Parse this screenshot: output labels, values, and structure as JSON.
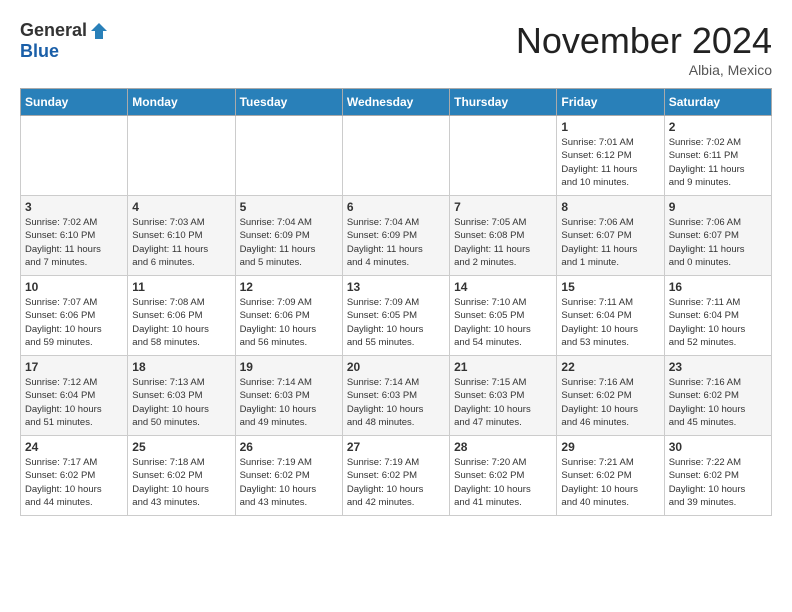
{
  "logo": {
    "general": "General",
    "blue": "Blue"
  },
  "title": "November 2024",
  "location": "Albia, Mexico",
  "days_of_week": [
    "Sunday",
    "Monday",
    "Tuesday",
    "Wednesday",
    "Thursday",
    "Friday",
    "Saturday"
  ],
  "weeks": [
    [
      {
        "day": "",
        "info": ""
      },
      {
        "day": "",
        "info": ""
      },
      {
        "day": "",
        "info": ""
      },
      {
        "day": "",
        "info": ""
      },
      {
        "day": "",
        "info": ""
      },
      {
        "day": "1",
        "info": "Sunrise: 7:01 AM\nSunset: 6:12 PM\nDaylight: 11 hours\nand 10 minutes."
      },
      {
        "day": "2",
        "info": "Sunrise: 7:02 AM\nSunset: 6:11 PM\nDaylight: 11 hours\nand 9 minutes."
      }
    ],
    [
      {
        "day": "3",
        "info": "Sunrise: 7:02 AM\nSunset: 6:10 PM\nDaylight: 11 hours\nand 7 minutes."
      },
      {
        "day": "4",
        "info": "Sunrise: 7:03 AM\nSunset: 6:10 PM\nDaylight: 11 hours\nand 6 minutes."
      },
      {
        "day": "5",
        "info": "Sunrise: 7:04 AM\nSunset: 6:09 PM\nDaylight: 11 hours\nand 5 minutes."
      },
      {
        "day": "6",
        "info": "Sunrise: 7:04 AM\nSunset: 6:09 PM\nDaylight: 11 hours\nand 4 minutes."
      },
      {
        "day": "7",
        "info": "Sunrise: 7:05 AM\nSunset: 6:08 PM\nDaylight: 11 hours\nand 2 minutes."
      },
      {
        "day": "8",
        "info": "Sunrise: 7:06 AM\nSunset: 6:07 PM\nDaylight: 11 hours\nand 1 minute."
      },
      {
        "day": "9",
        "info": "Sunrise: 7:06 AM\nSunset: 6:07 PM\nDaylight: 11 hours\nand 0 minutes."
      }
    ],
    [
      {
        "day": "10",
        "info": "Sunrise: 7:07 AM\nSunset: 6:06 PM\nDaylight: 10 hours\nand 59 minutes."
      },
      {
        "day": "11",
        "info": "Sunrise: 7:08 AM\nSunset: 6:06 PM\nDaylight: 10 hours\nand 58 minutes."
      },
      {
        "day": "12",
        "info": "Sunrise: 7:09 AM\nSunset: 6:06 PM\nDaylight: 10 hours\nand 56 minutes."
      },
      {
        "day": "13",
        "info": "Sunrise: 7:09 AM\nSunset: 6:05 PM\nDaylight: 10 hours\nand 55 minutes."
      },
      {
        "day": "14",
        "info": "Sunrise: 7:10 AM\nSunset: 6:05 PM\nDaylight: 10 hours\nand 54 minutes."
      },
      {
        "day": "15",
        "info": "Sunrise: 7:11 AM\nSunset: 6:04 PM\nDaylight: 10 hours\nand 53 minutes."
      },
      {
        "day": "16",
        "info": "Sunrise: 7:11 AM\nSunset: 6:04 PM\nDaylight: 10 hours\nand 52 minutes."
      }
    ],
    [
      {
        "day": "17",
        "info": "Sunrise: 7:12 AM\nSunset: 6:04 PM\nDaylight: 10 hours\nand 51 minutes."
      },
      {
        "day": "18",
        "info": "Sunrise: 7:13 AM\nSunset: 6:03 PM\nDaylight: 10 hours\nand 50 minutes."
      },
      {
        "day": "19",
        "info": "Sunrise: 7:14 AM\nSunset: 6:03 PM\nDaylight: 10 hours\nand 49 minutes."
      },
      {
        "day": "20",
        "info": "Sunrise: 7:14 AM\nSunset: 6:03 PM\nDaylight: 10 hours\nand 48 minutes."
      },
      {
        "day": "21",
        "info": "Sunrise: 7:15 AM\nSunset: 6:03 PM\nDaylight: 10 hours\nand 47 minutes."
      },
      {
        "day": "22",
        "info": "Sunrise: 7:16 AM\nSunset: 6:02 PM\nDaylight: 10 hours\nand 46 minutes."
      },
      {
        "day": "23",
        "info": "Sunrise: 7:16 AM\nSunset: 6:02 PM\nDaylight: 10 hours\nand 45 minutes."
      }
    ],
    [
      {
        "day": "24",
        "info": "Sunrise: 7:17 AM\nSunset: 6:02 PM\nDaylight: 10 hours\nand 44 minutes."
      },
      {
        "day": "25",
        "info": "Sunrise: 7:18 AM\nSunset: 6:02 PM\nDaylight: 10 hours\nand 43 minutes."
      },
      {
        "day": "26",
        "info": "Sunrise: 7:19 AM\nSunset: 6:02 PM\nDaylight: 10 hours\nand 43 minutes."
      },
      {
        "day": "27",
        "info": "Sunrise: 7:19 AM\nSunset: 6:02 PM\nDaylight: 10 hours\nand 42 minutes."
      },
      {
        "day": "28",
        "info": "Sunrise: 7:20 AM\nSunset: 6:02 PM\nDaylight: 10 hours\nand 41 minutes."
      },
      {
        "day": "29",
        "info": "Sunrise: 7:21 AM\nSunset: 6:02 PM\nDaylight: 10 hours\nand 40 minutes."
      },
      {
        "day": "30",
        "info": "Sunrise: 7:22 AM\nSunset: 6:02 PM\nDaylight: 10 hours\nand 39 minutes."
      }
    ]
  ]
}
